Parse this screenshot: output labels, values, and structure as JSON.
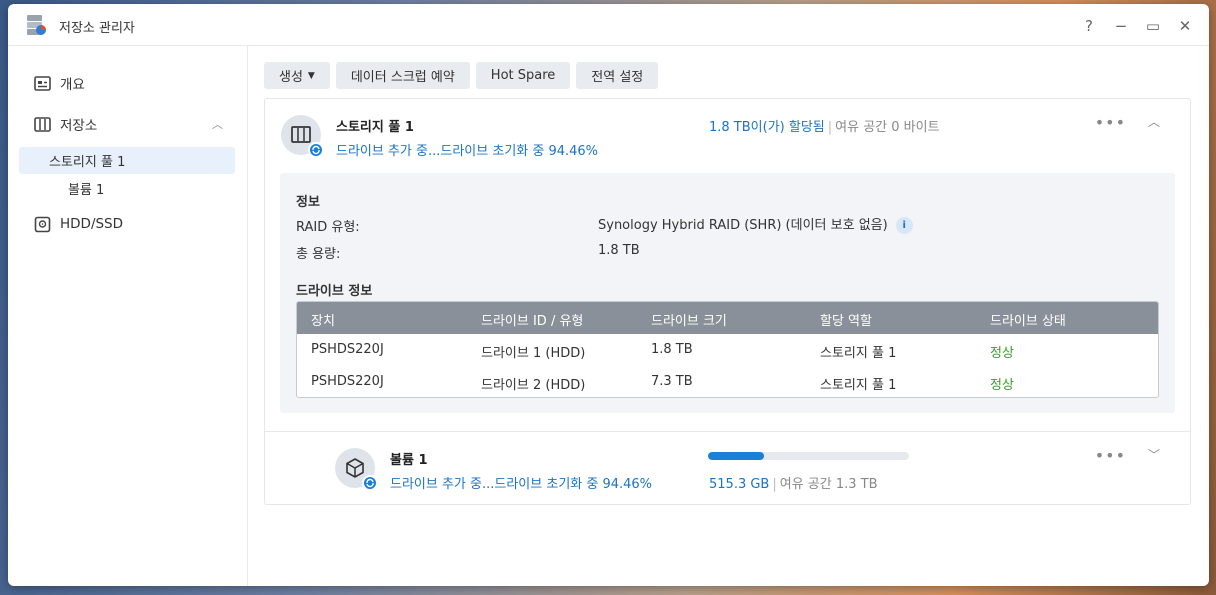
{
  "window": {
    "title": "저장소 관리자",
    "controls": {
      "help": "?",
      "minimize": "−",
      "maximize": "▭",
      "close": "✕"
    }
  },
  "sidebar": {
    "overview": "개요",
    "storage": "저장소",
    "pool": "스토리지 풀 1",
    "volume": "볼륨 1",
    "hdd": "HDD/SSD"
  },
  "toolbar": {
    "create": "생성",
    "scrub": "데이터 스크럽 예약",
    "hotspare": "Hot Spare",
    "global": "전역 설정"
  },
  "pool": {
    "title": "스토리지 풀 1",
    "status": "드라이브 추가 중...드라이브 초기화 중 94.46%",
    "allocated": "1.8 TB이(가) 할당됨",
    "free": "여유 공간 0 바이트",
    "info_title": "정보",
    "raid_label": "RAID 유형:",
    "raid_value": "Synology Hybrid RAID (SHR) (데이터 보호 없음)",
    "capacity_label": "총 용량:",
    "capacity_value": "1.8 TB",
    "drive_info_title": "드라이브 정보"
  },
  "drive_table": {
    "columns": [
      "장치",
      "드라이브 ID / 유형",
      "드라이브 크기",
      "할당 역할",
      "드라이브 상태"
    ],
    "rows": [
      [
        "PSHDS220J",
        "드라이브 1 (HDD)",
        "1.8 TB",
        "스토리지 풀 1",
        "정상"
      ],
      [
        "PSHDS220J",
        "드라이브 2 (HDD)",
        "7.3 TB",
        "스토리지 풀 1",
        "정상"
      ]
    ]
  },
  "volume": {
    "title": "볼륨 1",
    "status": "드라이브 추가 중...드라이브 초기화 중 94.46%",
    "used": "515.3 GB",
    "free": "여유 공간 1.3 TB",
    "usage_fraction": 0.28
  },
  "colors": {
    "accent": "#1a73c8",
    "ok": "#3a9a30",
    "table_header": "#8a9099"
  }
}
